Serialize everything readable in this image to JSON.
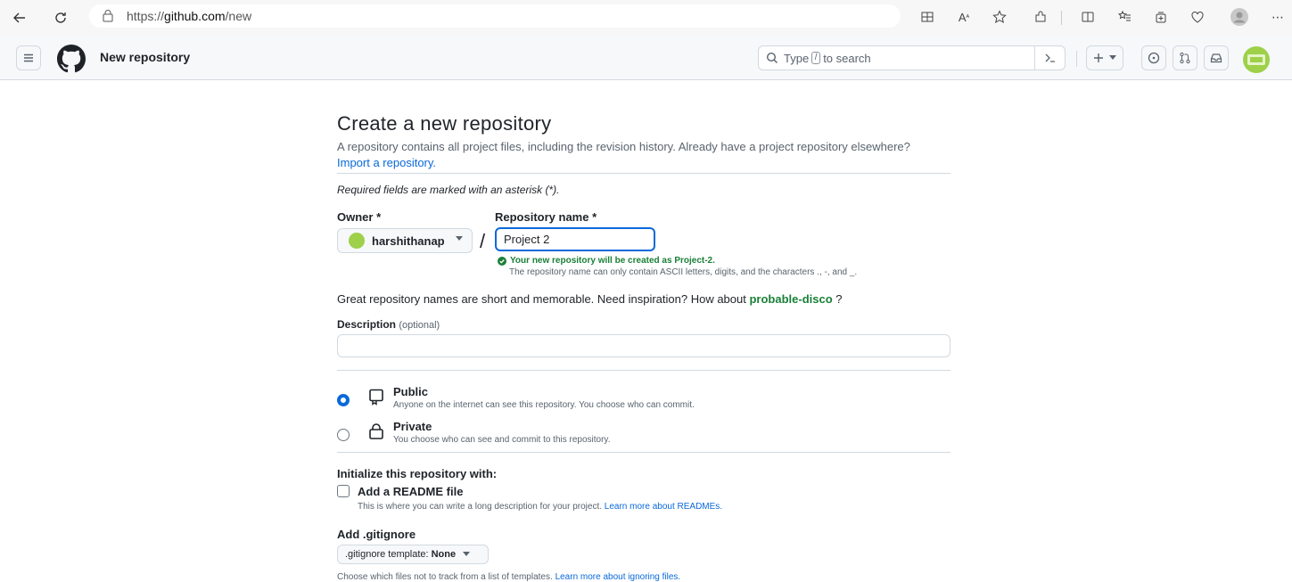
{
  "browser": {
    "url_prefix": "https://",
    "url_domain": "github.com",
    "url_path": "/new"
  },
  "header": {
    "title": "New repository",
    "search_prefix": "Type",
    "search_slash": "/",
    "search_suffix": "to search"
  },
  "page": {
    "heading": "Create a new repository",
    "lead_text": "A repository contains all project files, including the revision history. Already have a project repository elsewhere?",
    "import_link": "Import a repository.",
    "required_note": "Required fields are marked with an asterisk (*).",
    "owner_label": "Owner *",
    "owner_value": "harshithanap",
    "slash": "/",
    "repo_name_label": "Repository name *",
    "repo_name_value": "Project 2",
    "created_msg": "Your new repository will be created as Project-2.",
    "ascii_msg": "The repository name can only contain ASCII letters, digits, and the characters ., -, and _.",
    "great_prefix": "Great repository names are short and memorable. Need inspiration? How about",
    "great_suggestion": "probable-disco",
    "great_suffix": "?",
    "description_label": "Description",
    "description_optional": "(optional)",
    "description_value": ""
  },
  "visibility": {
    "public_title": "Public",
    "public_desc": "Anyone on the internet can see this repository. You choose who can commit.",
    "private_title": "Private",
    "private_desc": "You choose who can see and commit to this repository."
  },
  "init": {
    "label": "Initialize this repository with:",
    "readme_label": "Add a README file",
    "readme_desc": "This is where you can write a long description for your project.",
    "readme_link": "Learn more about READMEs.",
    "gitignore_label": "Add .gitignore",
    "gitignore_prefix": ".gitignore template:",
    "gitignore_value": "None",
    "gitignore_desc": "Choose which files not to track from a list of templates.",
    "gitignore_link": "Learn more about ignoring files."
  },
  "colors": {
    "accent": "#0969da",
    "success": "#1a7f37",
    "avatar": "#9ed04a"
  }
}
